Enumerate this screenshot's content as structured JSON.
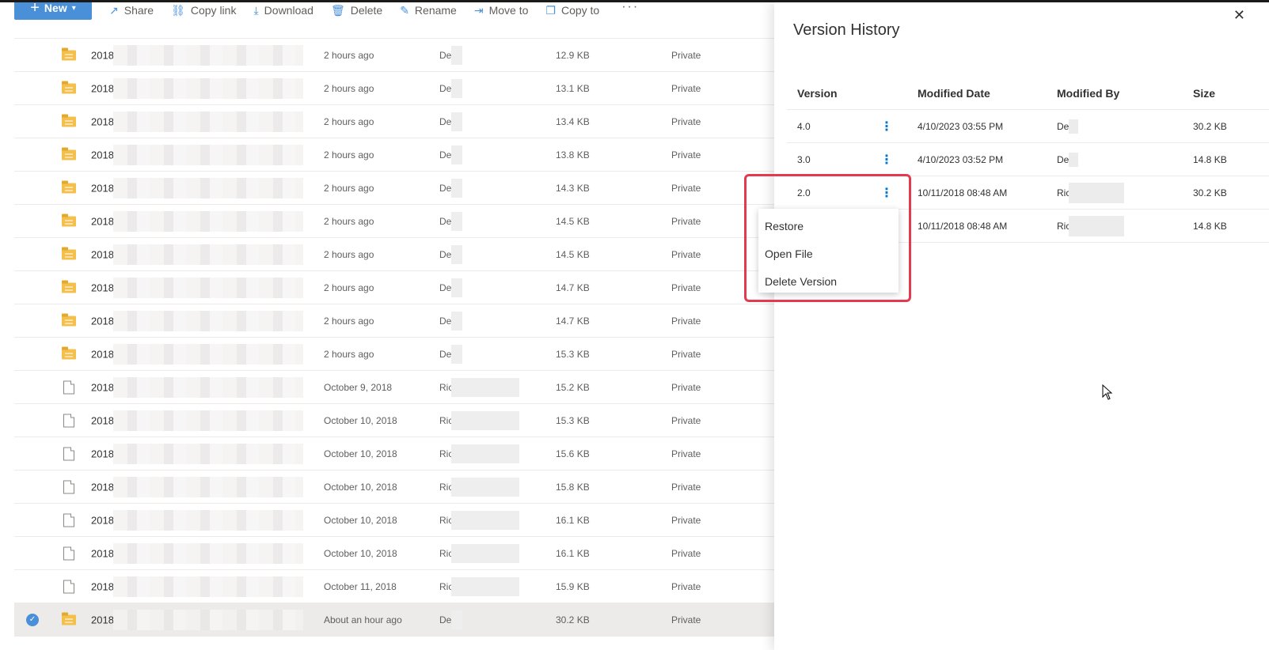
{
  "toolbar": {
    "new_label": "New",
    "items": [
      {
        "label": "Share",
        "icon": "share-icon",
        "glyph": "↗"
      },
      {
        "label": "Copy link",
        "icon": "link-icon",
        "glyph": "⛓"
      },
      {
        "label": "Download",
        "icon": "download-icon",
        "glyph": "⤓"
      },
      {
        "label": "Delete",
        "icon": "trash-icon",
        "glyph": "🗑"
      },
      {
        "label": "Rename",
        "icon": "rename-icon",
        "glyph": "✎"
      },
      {
        "label": "Move to",
        "icon": "move-icon",
        "glyph": "⇥"
      },
      {
        "label": "Copy to",
        "icon": "copy-icon",
        "glyph": "❐"
      }
    ],
    "more_label": "···"
  },
  "files": [
    {
      "kind": "folder",
      "name": "2018",
      "modified": "2 hours ago",
      "by": "De",
      "size": "12.9 KB",
      "sharing": "Private"
    },
    {
      "kind": "folder",
      "name": "2018",
      "modified": "2 hours ago",
      "by": "De",
      "size": "13.1 KB",
      "sharing": "Private"
    },
    {
      "kind": "folder",
      "name": "2018",
      "modified": "2 hours ago",
      "by": "De",
      "size": "13.4 KB",
      "sharing": "Private"
    },
    {
      "kind": "folder",
      "name": "2018",
      "modified": "2 hours ago",
      "by": "De",
      "size": "13.8 KB",
      "sharing": "Private"
    },
    {
      "kind": "folder",
      "name": "2018",
      "modified": "2 hours ago",
      "by": "De",
      "size": "14.3 KB",
      "sharing": "Private"
    },
    {
      "kind": "folder",
      "name": "2018",
      "modified": "2 hours ago",
      "by": "De",
      "size": "14.5 KB",
      "sharing": "Private"
    },
    {
      "kind": "folder",
      "name": "2018",
      "modified": "2 hours ago",
      "by": "De",
      "size": "14.5 KB",
      "sharing": "Private"
    },
    {
      "kind": "folder",
      "name": "2018",
      "modified": "2 hours ago",
      "by": "De",
      "size": "14.7 KB",
      "sharing": "Private"
    },
    {
      "kind": "folder",
      "name": "2018",
      "modified": "2 hours ago",
      "by": "De",
      "size": "14.7 KB",
      "sharing": "Private"
    },
    {
      "kind": "folder",
      "name": "2018",
      "modified": "2 hours ago",
      "by": "De",
      "size": "15.3 KB",
      "sharing": "Private"
    },
    {
      "kind": "file",
      "name": "2018",
      "modified": "October 9, 2018",
      "by": "Ric",
      "size": "15.2 KB",
      "sharing": "Private"
    },
    {
      "kind": "file",
      "name": "2018",
      "modified": "October 10, 2018",
      "by": "Ric",
      "size": "15.3 KB",
      "sharing": "Private"
    },
    {
      "kind": "file",
      "name": "2018",
      "modified": "October 10, 2018",
      "by": "Ric",
      "size": "15.6 KB",
      "sharing": "Private"
    },
    {
      "kind": "file",
      "name": "2018",
      "modified": "October 10, 2018",
      "by": "Ric",
      "size": "15.8 KB",
      "sharing": "Private"
    },
    {
      "kind": "file",
      "name": "2018",
      "modified": "October 10, 2018",
      "by": "Ric",
      "size": "16.1 KB",
      "sharing": "Private"
    },
    {
      "kind": "file",
      "name": "2018",
      "modified": "October 10, 2018",
      "by": "Ric",
      "size": "16.1 KB",
      "sharing": "Private"
    },
    {
      "kind": "file",
      "name": "2018",
      "modified": "October 11, 2018",
      "by": "Ric",
      "size": "15.9 KB",
      "sharing": "Private"
    },
    {
      "kind": "folder",
      "name": "2018",
      "modified": "About an hour ago",
      "by": "De",
      "size": "30.2 KB",
      "sharing": "Private",
      "selected": true
    }
  ],
  "panel": {
    "title": "Version History",
    "columns": {
      "version": "Version",
      "date": "Modified Date",
      "by": "Modified By",
      "size": "Size"
    },
    "versions": [
      {
        "version": "4.0",
        "date": "4/10/2023 03:55 PM",
        "by": "De",
        "size": "30.2 KB"
      },
      {
        "version": "3.0",
        "date": "4/10/2023 03:52 PM",
        "by": "De",
        "size": "14.8 KB"
      },
      {
        "version": "2.0",
        "date": "10/11/2018 08:48 AM",
        "by": "Ric",
        "size": "30.2 KB"
      },
      {
        "version": "",
        "date": "10/11/2018 08:48 AM",
        "by": "Ric",
        "size": "14.8 KB"
      }
    ]
  },
  "context_menu": {
    "items": [
      "Restore",
      "Open File",
      "Delete Version"
    ]
  },
  "colors": {
    "accent": "#4a90d9",
    "highlight": "#e53950",
    "folder": "#f4c04d"
  }
}
